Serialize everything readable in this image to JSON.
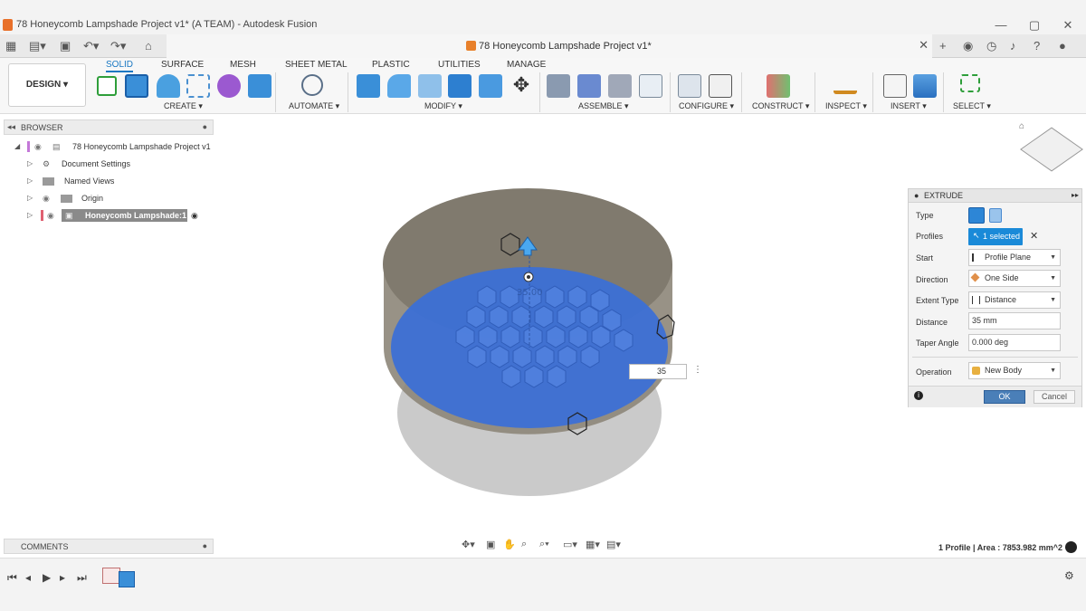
{
  "window": {
    "title": "78 Honeycomb Lampshade Project v1* (A TEAM) - Autodesk Fusion",
    "min": "—",
    "max": "▢",
    "close": "✕"
  },
  "doc_tab": {
    "title": "78 Honeycomb Lampshade Project v1*",
    "close": "✕"
  },
  "ribbon": {
    "workspace": "DESIGN",
    "tabs": [
      "SOLID",
      "SURFACE",
      "MESH",
      "SHEET METAL",
      "PLASTIC",
      "UTILITIES",
      "MANAGE"
    ],
    "groups": [
      "CREATE",
      "AUTOMATE",
      "MODIFY",
      "ASSEMBLE",
      "CONFIGURE",
      "CONSTRUCT",
      "INSPECT",
      "INSERT",
      "SELECT"
    ]
  },
  "browser": {
    "title": "BROWSER",
    "items": [
      "78 Honeycomb Lampshade Project v1",
      "Document Settings",
      "Named Views",
      "Origin",
      "Honeycomb Lampshade:1"
    ]
  },
  "extrude": {
    "title": "EXTRUDE",
    "labels": [
      "Type",
      "Profiles",
      "Start",
      "Direction",
      "Extent Type",
      "Distance",
      "Taper Angle",
      "Operation"
    ],
    "profiles_value": "1 selected",
    "start_value": "Profile Plane",
    "direction_value": "One Side",
    "extent_value": "Distance",
    "distance_value": "35 mm",
    "taper_value": "0.000 deg",
    "operation_value": "New Body",
    "ok_label": "OK",
    "cancel_label": "Cancel"
  },
  "viewport": {
    "distance_input": "35",
    "ghost_label": "35.00"
  },
  "comments": {
    "title": "COMMENTS"
  },
  "status": {
    "text": "1 Profile | Area : 7853.982 mm^2"
  },
  "colors": {
    "accent": "#1a78c2",
    "profile_blue": "#3a6fd8"
  }
}
